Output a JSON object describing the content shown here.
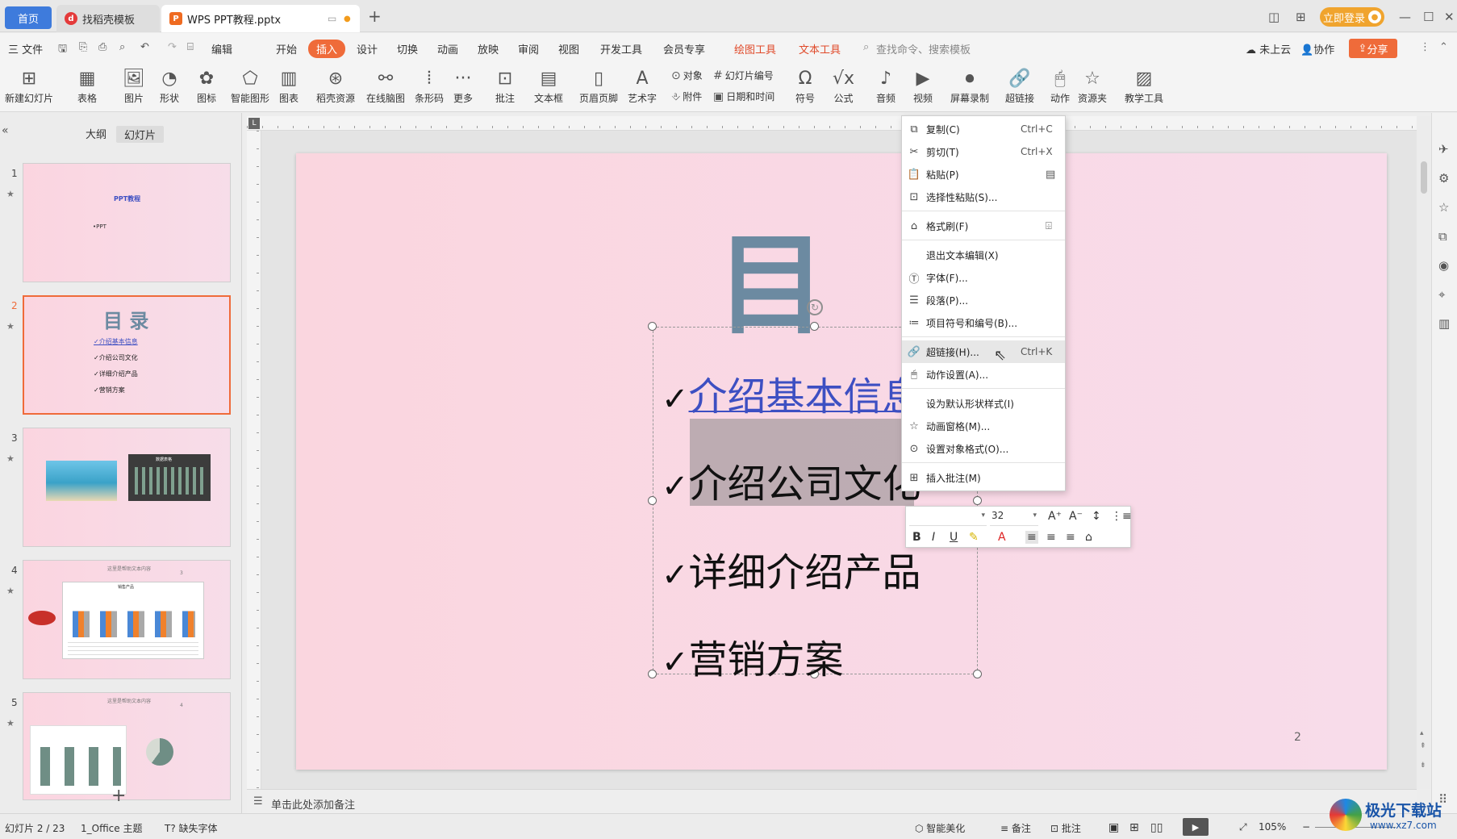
{
  "titlebar": {
    "tabs": [
      {
        "label": "首页"
      },
      {
        "label": "找稻壳模板"
      },
      {
        "label": "WPS PPT教程.pptx"
      }
    ],
    "new_tab": "+",
    "login": "立即登录"
  },
  "menubar": {
    "items": [
      {
        "label": "三 文件"
      },
      {
        "label": "编辑"
      },
      {
        "label": "开始"
      },
      {
        "label": "插入"
      },
      {
        "label": "设计"
      },
      {
        "label": "切换"
      },
      {
        "label": "动画"
      },
      {
        "label": "放映"
      },
      {
        "label": "审阅"
      },
      {
        "label": "视图"
      },
      {
        "label": "开发工具"
      },
      {
        "label": "会员专享"
      },
      {
        "label": "绘图工具"
      },
      {
        "label": "文本工具"
      }
    ],
    "search": "查找命令、搜索模板",
    "cloud": "未上云",
    "collab": "协作",
    "share": "分享"
  },
  "ribbon": {
    "big": [
      {
        "label": "新建幻灯片"
      },
      {
        "label": "表格"
      },
      {
        "label": "图片"
      },
      {
        "label": "形状"
      },
      {
        "label": "图标"
      },
      {
        "label": "智能图形"
      },
      {
        "label": "图表"
      },
      {
        "label": "稻壳资源"
      },
      {
        "label": "在线脑图"
      },
      {
        "label": "条形码"
      },
      {
        "label": "更多"
      },
      {
        "label": "批注"
      },
      {
        "label": "文本框"
      },
      {
        "label": "页眉页脚"
      },
      {
        "label": "艺术字"
      },
      {
        "label": "符号"
      },
      {
        "label": "公式"
      },
      {
        "label": "音频"
      },
      {
        "label": "视频"
      },
      {
        "label": "屏幕录制"
      },
      {
        "label": "超链接"
      },
      {
        "label": "动作"
      },
      {
        "label": "资源夹"
      },
      {
        "label": "教学工具"
      }
    ],
    "small": {
      "object": "对象",
      "attach": "附件",
      "slide_no": "幻灯片编号",
      "datetime": "日期和时间"
    }
  },
  "leftpanel": {
    "tab_outline": "大纲",
    "tab_slides": "幻灯片",
    "slides": [
      {
        "num": "1",
        "title": "PPT教程",
        "sub": "•PPT"
      },
      {
        "num": "2",
        "title": "目 录",
        "items": [
          "✓介绍基本信息",
          "✓介绍公司文化",
          "✓详细介绍产品",
          "✓营销方案"
        ]
      },
      {
        "num": "3",
        "chart_title": "数据表格"
      },
      {
        "num": "4",
        "header": "这里是帮助文本内容",
        "chart_title": "销售产品",
        "page": "3"
      },
      {
        "num": "5",
        "header": "这里是帮助文本内容",
        "page": "4"
      }
    ],
    "add": "+"
  },
  "slide": {
    "title": "目 录",
    "bullets": [
      {
        "check": "✓",
        "text": "介绍基本信息"
      },
      {
        "check": "✓",
        "text": "介绍公司文化"
      },
      {
        "check": "✓",
        "text": "详细介绍产品"
      },
      {
        "check": "✓",
        "text": "营销方案"
      }
    ],
    "page_number": "2"
  },
  "context_menu": [
    {
      "label": "复制(C)",
      "shortcut": "Ctrl+C",
      "icon": "copy-icon"
    },
    {
      "label": "剪切(T)",
      "shortcut": "Ctrl+X",
      "icon": "scissors-icon"
    },
    {
      "label": "粘贴(P)",
      "icon": "paste-icon"
    },
    {
      "label": "选择性粘贴(S)...",
      "icon": "paste-special-icon"
    },
    {
      "label": "格式刷(F)",
      "icon": "format-brush-icon"
    },
    {
      "label": "退出文本编辑(X)"
    },
    {
      "label": "字体(F)...",
      "icon": "font-icon"
    },
    {
      "label": "段落(P)...",
      "icon": "paragraph-icon"
    },
    {
      "label": "项目符号和编号(B)...",
      "icon": "list-icon"
    },
    {
      "label": "超链接(H)...",
      "shortcut": "Ctrl+K",
      "icon": "link-icon"
    },
    {
      "label": "动作设置(A)...",
      "icon": "action-icon"
    },
    {
      "label": "设为默认形状样式(I)"
    },
    {
      "label": "动画窗格(M)...",
      "icon": "animation-icon"
    },
    {
      "label": "设置对象格式(O)...",
      "icon": "format-object-icon"
    },
    {
      "label": "插入批注(M)",
      "icon": "comment-icon"
    }
  ],
  "mini_toolbar": {
    "font_size": "32"
  },
  "notes": {
    "placeholder": "单击此处添加备注"
  },
  "status": {
    "slide_info": "幻灯片 2 / 23",
    "theme": "1_Office 主题",
    "missing_font": "缺失字体",
    "beautify": "智能美化",
    "notes": "备注",
    "comment": "批注",
    "zoom": "105%"
  },
  "watermark": {
    "text": "极光下载站",
    "url": "www.xz7.com"
  },
  "colors": {
    "accent": "#ef6b3a",
    "home_tab": "#3e7bdc",
    "title_text": "#6c8aa1",
    "link_text": "#3d4fc2"
  }
}
